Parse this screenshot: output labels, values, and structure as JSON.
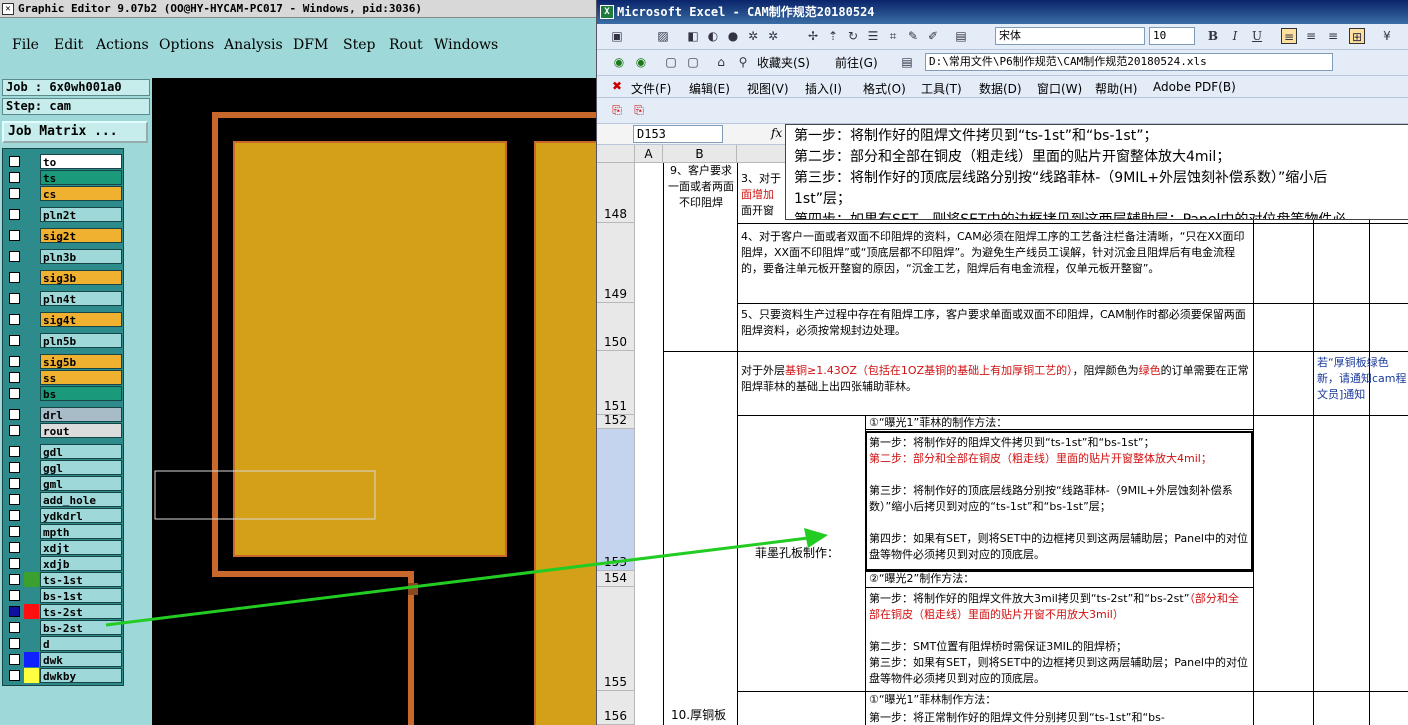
{
  "ge": {
    "title": "Graphic Editor 9.07b2 (OO@HY-HYCAM-PC017 - Windows, pid:3036)",
    "menu": [
      "File",
      "Edit",
      "Actions",
      "Options",
      "Analysis",
      "DFM",
      "Step",
      "Rout",
      "Windows"
    ],
    "job": "Job : 6x0wh001a0",
    "step": "Step: cam",
    "job_matrix": "Job Matrix ...",
    "layers": [
      {
        "name": "to",
        "color": "#ffffff"
      },
      {
        "name": "ts",
        "color": "#1a9a7a"
      },
      {
        "name": "cs",
        "color": "#f0b030"
      },
      {
        "name": "pln2t",
        "color": "#9fd8d8"
      },
      {
        "name": "sig2t",
        "color": "#f0b030"
      },
      {
        "name": "pln3b",
        "color": "#9fd8d8"
      },
      {
        "name": "sig3b",
        "color": "#f0b030"
      },
      {
        "name": "pln4t",
        "color": "#9fd8d8"
      },
      {
        "name": "sig4t",
        "color": "#f0b030"
      },
      {
        "name": "pln5b",
        "color": "#9fd8d8"
      },
      {
        "name": "sig5b",
        "color": "#f0b030"
      },
      {
        "name": "ss",
        "color": "#f0b030"
      },
      {
        "name": "bs",
        "color": "#1a9a7a"
      },
      {
        "name": "drl",
        "color": "#a8bcc8"
      },
      {
        "name": "rout",
        "color": "#dcdcdc"
      },
      {
        "name": "gdl",
        "color": "#9fd8d8"
      },
      {
        "name": "ggl",
        "color": "#9fd8d8"
      },
      {
        "name": "gml",
        "color": "#9fd8d8"
      },
      {
        "name": "add_hole",
        "color": "#9fd8d8"
      },
      {
        "name": "ydkdrl",
        "color": "#9fd8d8"
      },
      {
        "name": "mpth",
        "color": "#9fd8d8"
      },
      {
        "name": "xdjt",
        "color": "#9fd8d8"
      },
      {
        "name": "xdjb",
        "color": "#9fd8d8"
      },
      {
        "name": "ts-1st",
        "color": "#9fd8d8"
      },
      {
        "name": "bs-1st",
        "color": "#9fd8d8"
      },
      {
        "name": "ts-2st",
        "color": "#9fd8d8"
      },
      {
        "name": "bs-2st",
        "color": "#9fd8d8"
      },
      {
        "name": "d",
        "color": "#9fd8d8"
      },
      {
        "name": "dwk",
        "color": "#9fd8d8"
      },
      {
        "name": "dwkby",
        "color": "#9fd8d8"
      }
    ],
    "swatches": {
      "ts-1st": "#3aa030",
      "ts-2st": "#ff1010",
      "dwk": "#1020ff",
      "dwkby": "#ffff40"
    },
    "colors": {
      "copper": "#d4a017",
      "outline": "#c8682a"
    }
  },
  "xl": {
    "title": "Microsoft Excel - CAM制作规范20180524",
    "font_name": "宋体",
    "font_size": "10",
    "favorites": "收藏夹(S)",
    "goto": "前往(G)",
    "path": "D:\\常用文件\\P6制作规范\\CAM制作规范20180524.xls",
    "menu": [
      "文件(F)",
      "编辑(E)",
      "视图(V)",
      "插入(I)",
      "格式(O)",
      "工具(T)",
      "数据(D)",
      "窗口(W)",
      "帮助(H)",
      "Adobe PDF(B)"
    ],
    "name_box": "D153",
    "fx": "fx",
    "tooltip": [
      "第一步：将制作好的阻焊文件拷贝到“ts-1st”和“bs-1st”；",
      "第二步：部分和全部在铜皮（粗走线）里面的贴片开窗整体放大4mil；",
      "第三步：将制作好的顶底层线路分别按“线路菲林-（9MIL+外层蚀刻补偿系数）”缩小后",
      "1st”层；",
      "第四步：如果有SET，则将SET中的边框拷贝到这两层辅助层；Panel中的对位盘等物件必"
    ],
    "cols": [
      "A",
      "B"
    ],
    "rows": [
      "148",
      "149",
      "150",
      "151",
      "152",
      "153",
      "154",
      "155",
      "156"
    ],
    "b148": "9、客户要求一面或者两面不印阻焊",
    "c148": [
      "3、对于",
      "面增加",
      "面开窗"
    ],
    "c149": "4、对于客户一面或者双面不印阻焊的资料，CAM必须在阻焊工序的工艺备注栏备注清晰，“只在XX面印阻焊，XX面不印阻焊”或“顶底层都不印阻焊”。为避免生产线员工误解，针对沉金且阻焊后有电金流程的，要备注单元板开整窗的原因，“沉金工艺，阻焊后有电金流程，仅单元板开整窗”。",
    "c150": "5、只要资料生产过程中存在有阻焊工序，客户要求单面或双面不印阻焊，CAM制作时都必须要保留两面阻焊资料，必须按常规封边处理。",
    "c151": {
      "p1": "对于外层",
      "p2": "基铜≥1.43OZ",
      "p3": "（包括在1OZ基铜的基础上有加厚铜工艺的）",
      "p4": "，阻焊颜色为",
      "p5": "绿色",
      "p6": "的订单需要在正常阻焊菲林的基础上出四张辅助菲林。"
    },
    "e151": "若“厚铜板绿色新，请通知cam程文员]通知",
    "side_label": "菲墨孔板制作：",
    "d152": "①“曝光1”菲林的制作方法：",
    "d153": {
      "s1": "第一步：将制作好的阻焊文件拷贝到“ts-1st”和“bs-1st”；",
      "s2": "第二步：部分和全部在铜皮（粗走线）里面的贴片开窗整体放大4mil；",
      "s3": "第三步：将制作好的顶底层线路分别按“线路菲林-（9MIL+外层蚀刻补偿系数）”缩小后拷贝到对应的“ts-1st”和“bs-1st”层；",
      "s4": "第四步：如果有SET，则将SET中的边框拷贝到这两层辅助层；Panel中的对位盘等物件必须拷贝到对应的顶底层。"
    },
    "d154": "②“曝光2”制作方法：",
    "d155": {
      "s1a": "第一步：将制作好的阻焊文件放大3mil拷贝到“ts-2st”和“bs-2st”",
      "s1b": "（部分和全部在铜皮（粗走线）里面的贴片开窗不用放大3mil）",
      "s2": "第二步：SMT位置有阻焊桥时需保证3MIL的阻焊桥；",
      "s3": "第三步：如果有SET，则将SET中的边框拷贝到这两层辅助层；Panel中的对位盘等物件必须拷贝到对应的顶底层。"
    },
    "b156": "10.厚铜板",
    "d156a": "①“曝光1”菲林制作方法：",
    "d156b": "第一步：将正常制作好的阻焊文件分别拷贝到“ts-1st”和“bs-"
  },
  "arrow_color": "#22cc22"
}
